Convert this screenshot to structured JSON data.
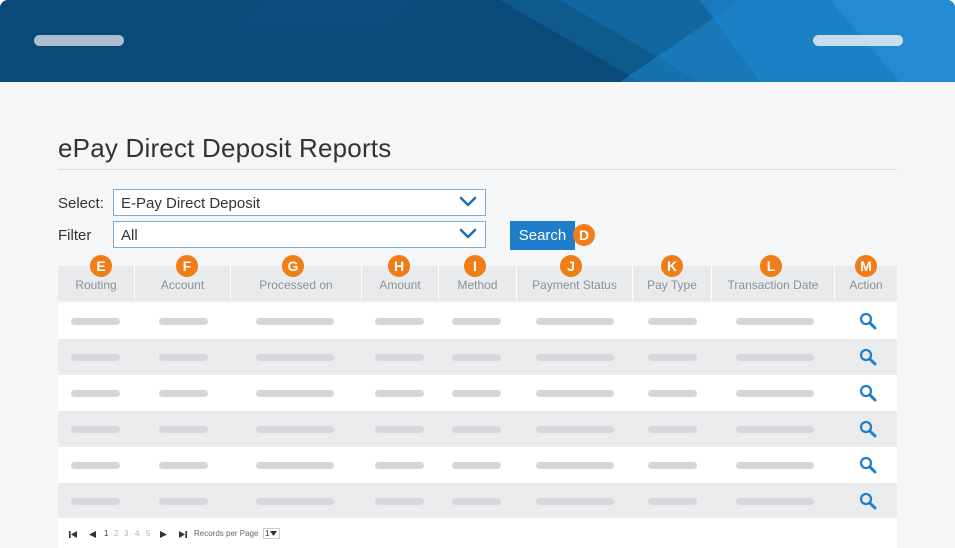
{
  "page": {
    "title": "ePay Direct Deposit Reports"
  },
  "form": {
    "select_label": "Select:",
    "select_value": "E-Pay Direct Deposit",
    "filter_label": "Filter",
    "filter_value": "All",
    "search_label": "Search"
  },
  "badges": {
    "search": "D",
    "columns": [
      "E",
      "F",
      "G",
      "H",
      "I",
      "J",
      "K",
      "L",
      "M"
    ]
  },
  "table": {
    "columns": [
      "Routing",
      "Account",
      "Processed on",
      "Amount",
      "Method",
      "Payment Status",
      "Pay Type",
      "Transaction Date",
      "Action"
    ],
    "row_count": 6,
    "action_icon": "search-icon"
  },
  "pager": {
    "pages": [
      "1",
      "2",
      "3",
      "4",
      "5"
    ],
    "current_page": "1",
    "records_label": "Records per Page",
    "records_value": "1"
  },
  "colors": {
    "header": "#0a4a78",
    "accent": "#1f7ecb",
    "badge": "#f07d17"
  }
}
